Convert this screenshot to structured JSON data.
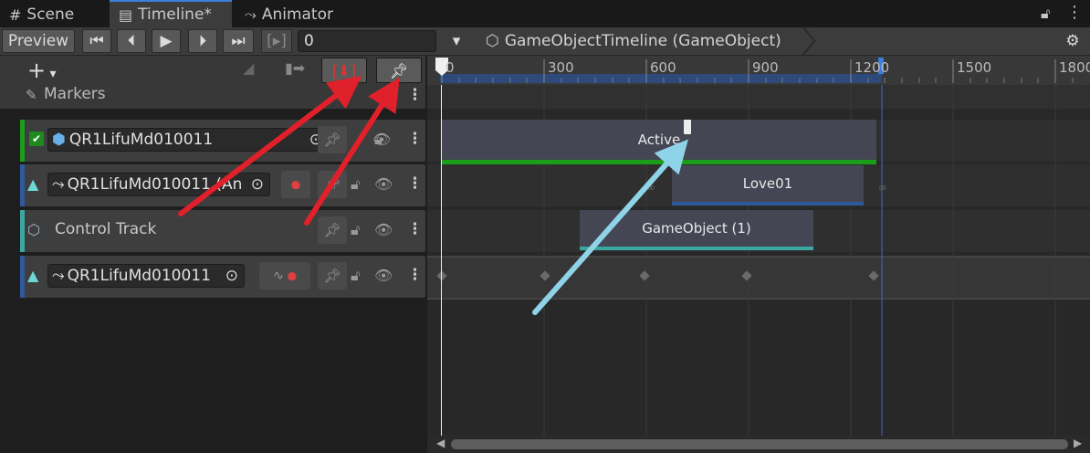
{
  "tabs": [
    {
      "label": "Scene",
      "icon": "#"
    },
    {
      "label": "Timeline*",
      "icon": "▤"
    },
    {
      "label": "Animator",
      "icon": "⤳"
    }
  ],
  "toolbar": {
    "preview_label": "Preview",
    "frame_value": "0",
    "breadcrumb": "GameObjectTimeline (GameObject)"
  },
  "ruler": {
    "ticks": [
      "0",
      "300",
      "600",
      "900",
      "1200",
      "1500",
      "1800"
    ]
  },
  "markers_label": "Markers",
  "tracks": [
    {
      "name": "QR1LifuMd010011",
      "type": "activation",
      "clip": "Active"
    },
    {
      "name": "QR1LifuMd010011 (An",
      "type": "animation",
      "clip": "Love01"
    },
    {
      "name": "Control Track",
      "type": "control",
      "clip": "GameObject (1)"
    },
    {
      "name": "QR1LifuMd010011",
      "type": "animation-recordable",
      "clip": ""
    }
  ],
  "colors": {
    "accent": "#3d7edb",
    "activation": "#1b9c1b",
    "animation": "#2e5a9c",
    "control": "#3aa8a0",
    "red_arrow": "#e0202a",
    "blue_arrow": "#8fd3e8"
  }
}
